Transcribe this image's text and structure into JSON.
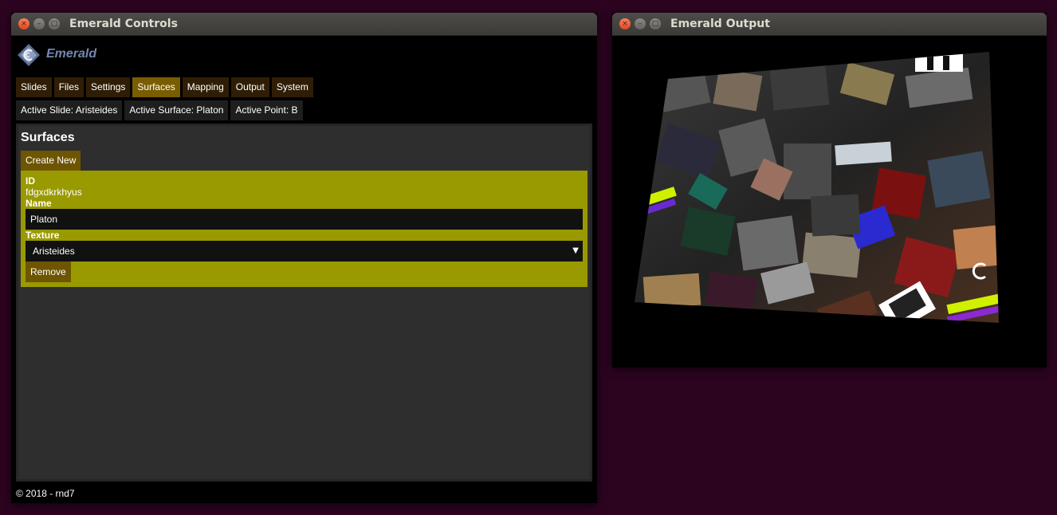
{
  "windows": {
    "controls": {
      "title": "Emerald Controls"
    },
    "output": {
      "title": "Emerald Output"
    }
  },
  "titlebar_buttons": {
    "close": "×",
    "minimize": "–",
    "maximize": "□"
  },
  "app": {
    "logo_text": "Emerald"
  },
  "nav": {
    "tabs": [
      {
        "label": "Slides",
        "active": false
      },
      {
        "label": "Files",
        "active": false
      },
      {
        "label": "Settings",
        "active": false
      },
      {
        "label": "Surfaces",
        "active": true
      },
      {
        "label": "Mapping",
        "active": false
      },
      {
        "label": "Output",
        "active": false
      },
      {
        "label": "System",
        "active": false
      }
    ]
  },
  "status": {
    "active_slide": "Active Slide: Aristeides",
    "active_surface": "Active Surface: Platon",
    "active_point": "Active Point: B"
  },
  "surfaces": {
    "heading": "Surfaces",
    "create_label": "Create New",
    "item": {
      "id_label": "ID",
      "id_value": "fdgxdkrkhyus",
      "name_label": "Name",
      "name_value": "Platon",
      "texture_label": "Texture",
      "texture_value": "Aristeides",
      "remove_label": "Remove"
    }
  },
  "footer": "© 2018 - rnd7",
  "colors": {
    "desktop": "#2c0420",
    "tab": "#2f1e05",
    "tab_active": "#7a5d00",
    "card": "#999900",
    "button": "#6e5500",
    "logo": "#7488b0"
  },
  "icons": {
    "close": "close-icon",
    "minimize": "minimize-icon",
    "maximize": "maximize-icon",
    "logo": "emerald-logo-icon",
    "dropdown": "chevron-down-icon"
  }
}
